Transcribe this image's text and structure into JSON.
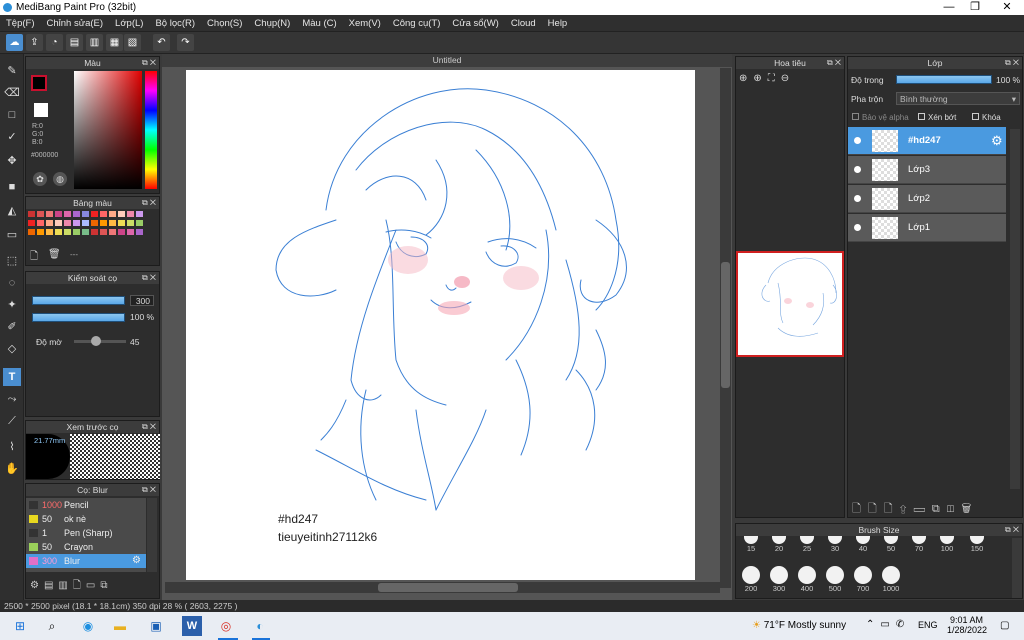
{
  "app": {
    "title": "MediBang Paint Pro (32bit)"
  },
  "menu": [
    "Tệp(F)",
    "Chỉnh sửa(E)",
    "Lớp(L)",
    "Bộ lọc(R)",
    "Chọn(S)",
    "Chụp(N)",
    "Màu (C)",
    "Xem(V)",
    "Công cụ(T)",
    "Cửa sổ(W)",
    "Cloud",
    "Help"
  ],
  "color_panel": {
    "title": "Màu",
    "r": "R:0",
    "g": "G:0",
    "b": "B:0",
    "hex": "#000000",
    "fg_color": "#000000"
  },
  "palette_panel": {
    "title": "Bảng màu",
    "dash": "---"
  },
  "brush_control": {
    "title": "Kiểm soát cọ",
    "size_value": "300",
    "opacity_value": "100 %",
    "blur_label": "Độ mờ",
    "blur_value": "45",
    "size_fill": 1.0,
    "opacity_fill": 1.0,
    "blur_fill": 0.45
  },
  "brush_preview": {
    "title": "Xem trước cọ",
    "size_text": "21.77mm"
  },
  "brush_list": {
    "title": "Cọ: Blur",
    "items": [
      {
        "size": "1000",
        "name": "Pencil",
        "color": "#333333"
      },
      {
        "size": "50",
        "name": "ok nè",
        "color": "#e8d820"
      },
      {
        "size": "1",
        "name": "Pen (Sharp)",
        "color": "#333333"
      },
      {
        "size": "50",
        "name": "Crayon",
        "color": "#9ad05a"
      },
      {
        "size": "300",
        "name": "Blur",
        "color": "#e070c8",
        "selected": true
      }
    ]
  },
  "canvas": {
    "tab": "Untitled",
    "sig_line1": "#hd247",
    "sig_line2": "tieuyeitinh27112k6"
  },
  "navigator": {
    "title": "Hoa tiêu"
  },
  "layers_panel": {
    "title": "Lớp",
    "opacity_label": "Độ trong",
    "opacity_value": "100 %",
    "blend_label": "Pha trộn",
    "blend_value": "Bình thường",
    "protect_alpha": "Bảo vệ alpha",
    "clip": "Xén bớt",
    "lock": "Khóa",
    "layers": [
      {
        "name": "#hd247",
        "selected": true
      },
      {
        "name": "Lớp3"
      },
      {
        "name": "Lớp2"
      },
      {
        "name": "Lớp1"
      }
    ]
  },
  "brush_size": {
    "title": "Brush Size",
    "row1": [
      "15",
      "20",
      "25",
      "30",
      "40",
      "50",
      "70",
      "100",
      "150"
    ],
    "row2": [
      "200",
      "300",
      "400",
      "500",
      "700",
      "1000"
    ]
  },
  "status": {
    "text": "2500 * 2500 pixel  (18.1 * 18.1cm)  350 dpi  28 %  ( 2603, 2275 )"
  },
  "taskbar": {
    "weather": "71°F  Mostly sunny",
    "lang": "ENG",
    "time": "9:01 AM",
    "date": "1/28/2022"
  }
}
